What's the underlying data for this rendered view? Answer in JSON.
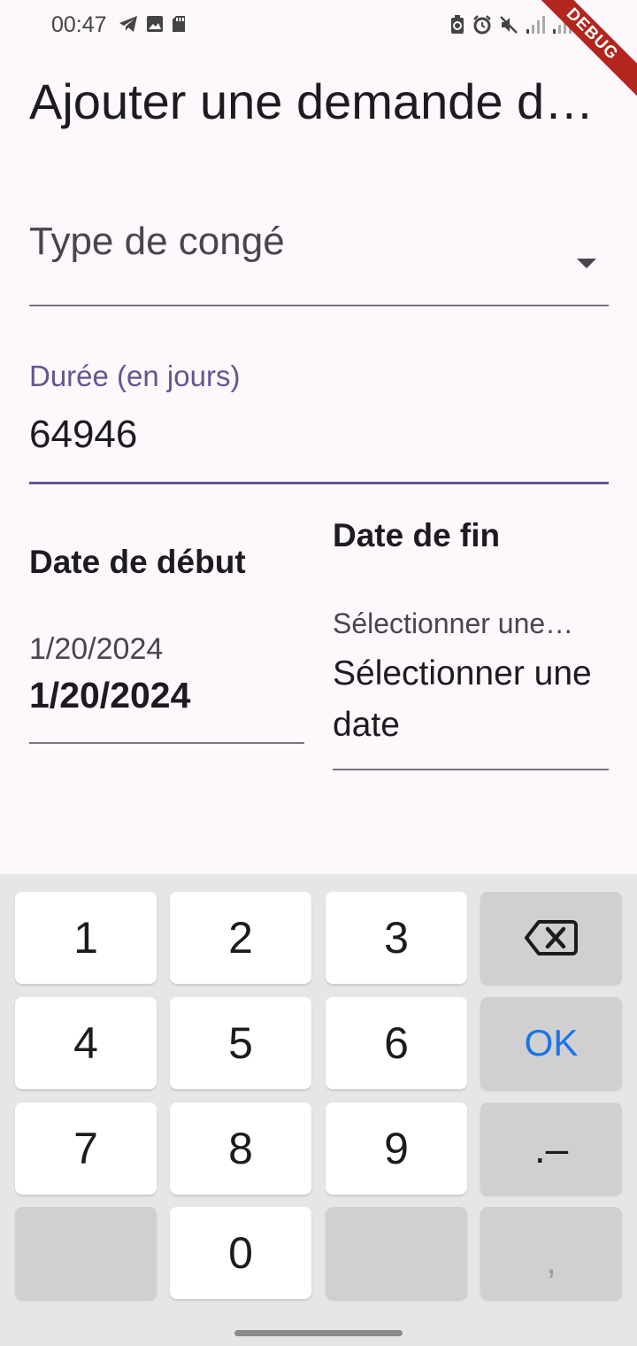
{
  "status_bar": {
    "time": "00:47",
    "left_icons": [
      "telegram-icon",
      "image-icon",
      "sd-card-icon"
    ],
    "right_icons": [
      "battery-saver-icon",
      "alarm-icon",
      "mute-icon",
      "signal-icon",
      "signal-icon"
    ]
  },
  "debug_banner": "DEBUG",
  "page": {
    "title": "Ajouter une demande d…"
  },
  "form": {
    "leave_type": {
      "label": "Type de congé"
    },
    "duration": {
      "label": "Durée (en jours)",
      "value": "64946"
    },
    "start_date": {
      "heading": "Date de début",
      "label": "1/20/2024",
      "value": "1/20/2024"
    },
    "end_date": {
      "heading": "Date de fin",
      "label": "Sélectionner une…",
      "value": "Sélectionner une date"
    }
  },
  "keyboard": {
    "row1": [
      "1",
      "2",
      "3"
    ],
    "row2": [
      "4",
      "5",
      "6"
    ],
    "row3": [
      "7",
      "8",
      "9"
    ],
    "zero": "0",
    "ok_label": "OK",
    "symbol_label": ".–",
    "comma_label": ","
  },
  "colors": {
    "accent": "#65558f",
    "background": "#fdf8fc",
    "ok_blue": "#1a73e8"
  }
}
